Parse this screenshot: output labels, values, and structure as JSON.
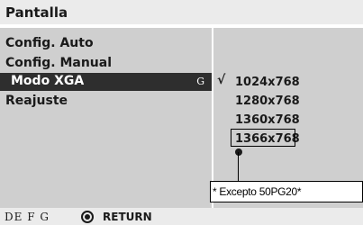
{
  "header": {
    "title": "Pantalla"
  },
  "menu": {
    "items": [
      {
        "label": "Config. Auto"
      },
      {
        "label": "Config. Manual"
      },
      {
        "label": "Modo XGA",
        "hint": "G",
        "selected": true
      },
      {
        "label": "Reajuste"
      }
    ]
  },
  "options": {
    "check_mark": "√",
    "items": [
      "1024x768",
      "1280x768",
      "1360x768",
      "1366x768"
    ]
  },
  "note": {
    "text": "* Excepto 50PG20*"
  },
  "footer": {
    "keys": "DE F G",
    "return_label": "RETURN"
  },
  "colors": {
    "panel": "#cfcfcf",
    "header": "#ebebeb",
    "selected": "#2e2e2e",
    "text": "#1a1a1a"
  },
  "icons": [
    "ok-circle-icon"
  ]
}
